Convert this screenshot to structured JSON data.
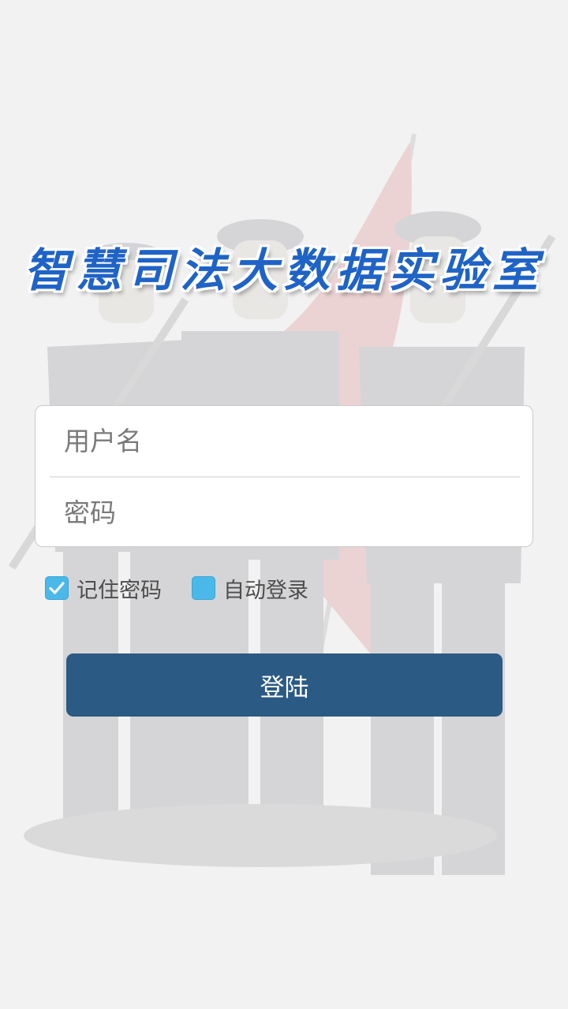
{
  "app": {
    "title": "智慧司法大数据实验室"
  },
  "form": {
    "username": {
      "value": "",
      "placeholder": "用户名"
    },
    "password": {
      "value": "",
      "placeholder": "密码"
    }
  },
  "options": {
    "remember_password": {
      "label": "记住密码",
      "checked": true
    },
    "auto_login": {
      "label": "自动登录",
      "checked": false
    }
  },
  "login_button": {
    "label": "登陆"
  },
  "colors": {
    "title": "#1f63c6",
    "checkbox": "#4ab8e9",
    "button": "#2b5a84",
    "background": "#f2f2f2"
  },
  "icons": {
    "background": "honor-guard-background-image",
    "check": "check-icon"
  }
}
